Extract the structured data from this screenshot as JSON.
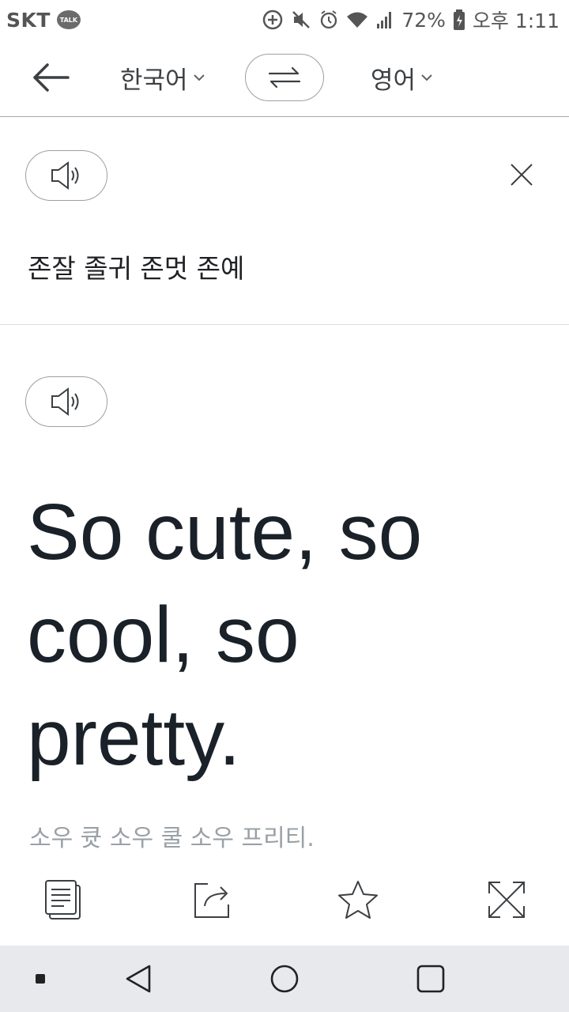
{
  "status_bar": {
    "carrier": "SKT",
    "talk_badge": "TALK",
    "battery": "72%",
    "time": "오후 1:11",
    "icons": [
      "data-saver-icon",
      "mute-icon",
      "alarm-icon",
      "wifi-icon",
      "signal-icon",
      "battery-icon"
    ]
  },
  "top_bar": {
    "source_language": "한국어",
    "target_language": "영어",
    "icons": [
      "back-arrow-icon",
      "chevron-down-icon",
      "swap-icon"
    ]
  },
  "source": {
    "text": "존잘 졸귀 존멋 존예",
    "icons": [
      "speaker-icon",
      "close-icon"
    ]
  },
  "result": {
    "translation": "So cute, so cool, so pretty.",
    "romanization": "소우 큣 소우 쿨 소우 프리티.",
    "icons": [
      "speaker-icon"
    ]
  },
  "actions": {
    "icons": [
      "copy-icon",
      "share-icon",
      "star-icon",
      "fullscreen-icon"
    ]
  },
  "nav_bar": {
    "icons": [
      "nav-dot-icon",
      "nav-back-icon",
      "nav-home-icon",
      "nav-recents-icon"
    ]
  },
  "colors": {
    "text_primary": "#1a2128",
    "text_secondary": "#9aa0a6",
    "divider": "#a9a9a9",
    "nav_bar_bg": "#e8e9ec"
  }
}
